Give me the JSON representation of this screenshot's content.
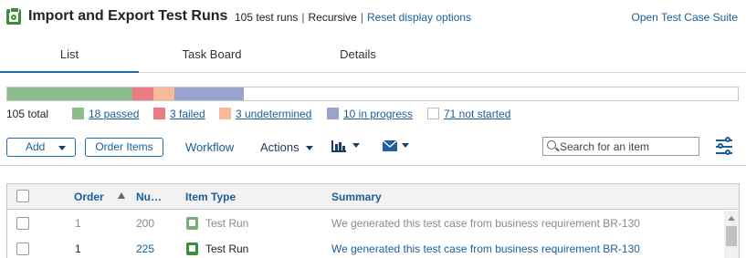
{
  "header": {
    "title": "Import and Export Test Runs",
    "count": "105 test runs",
    "recursive": "Recursive",
    "separator": "|",
    "reset_link": "Reset display options",
    "open_suite": "Open Test Case Suite"
  },
  "tabs": [
    {
      "label": "List",
      "active": true
    },
    {
      "label": "Task Board",
      "active": false
    },
    {
      "label": "Details",
      "active": false
    }
  ],
  "progress": {
    "total_label": "105 total",
    "total": 105,
    "segments": [
      {
        "label": "18 passed",
        "value": 18,
        "color": "#8dbd8c"
      },
      {
        "label": "3 failed",
        "value": 3,
        "color": "#ec7a83"
      },
      {
        "label": "3 undetermined",
        "value": 3,
        "color": "#f8b89a"
      },
      {
        "label": "10 in progress",
        "value": 10,
        "color": "#9aa3cd"
      },
      {
        "label": "71 not started",
        "value": 71,
        "color": "#ffffff"
      }
    ]
  },
  "toolbar": {
    "add_label": "Add",
    "order_items_label": "Order Items",
    "workflow_label": "Workflow",
    "actions_label": "Actions",
    "search_placeholder": "Search for an item"
  },
  "grid": {
    "columns": {
      "order": "Order",
      "number": "Nu…",
      "item_type": "Item Type",
      "summary": "Summary"
    },
    "rows": [
      {
        "order": "1",
        "number": "200",
        "item_type": "Test Run",
        "summary": "We generated this test case from business requirement BR-130",
        "muted": true
      },
      {
        "order": "1",
        "number": "225",
        "item_type": "Test Run",
        "summary": "We generated this test case from business requirement BR-130",
        "muted": false
      }
    ]
  },
  "colors": {
    "accent": "#1a6db3",
    "link": "#1a5e9a",
    "test_run_icon": "#3c8f3a"
  }
}
